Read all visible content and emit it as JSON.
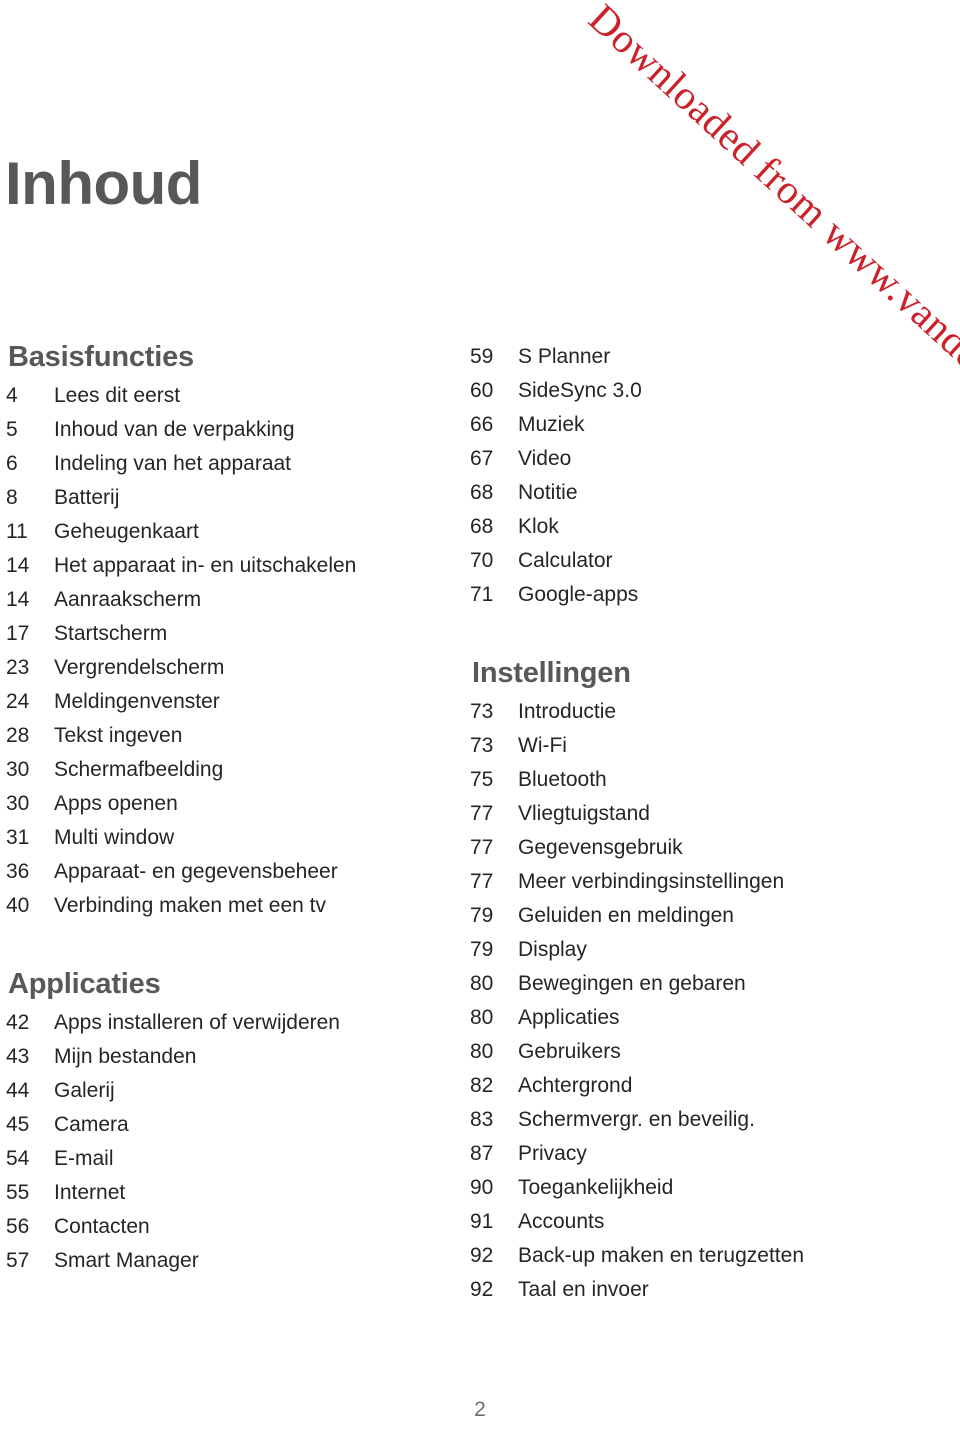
{
  "document": {
    "title": "Inhoud",
    "page_number": "2",
    "watermark_text": "Downloaded from www.vandenborre.be",
    "colors": {
      "watermark_red": "#cc2128",
      "heading_gray": "#58585a",
      "body_text": "#282425",
      "page_number_gray": "#6d6e70",
      "background": "#ffffff"
    }
  },
  "left_column": {
    "sections": [
      {
        "title": "Basisfuncties",
        "entries": [
          {
            "page": "4",
            "label": "Lees dit eerst"
          },
          {
            "page": "5",
            "label": "Inhoud van de verpakking"
          },
          {
            "page": "6",
            "label": "Indeling van het apparaat"
          },
          {
            "page": "8",
            "label": "Batterij"
          },
          {
            "page": "11",
            "label": "Geheugenkaart"
          },
          {
            "page": "14",
            "label": "Het apparaat in- en uitschakelen"
          },
          {
            "page": "14",
            "label": "Aanraakscherm"
          },
          {
            "page": "17",
            "label": "Startscherm"
          },
          {
            "page": "23",
            "label": "Vergrendelscherm"
          },
          {
            "page": "24",
            "label": "Meldingenvenster"
          },
          {
            "page": "28",
            "label": "Tekst ingeven"
          },
          {
            "page": "30",
            "label": "Schermafbeelding"
          },
          {
            "page": "30",
            "label": "Apps openen"
          },
          {
            "page": "31",
            "label": "Multi window"
          },
          {
            "page": "36",
            "label": "Apparaat- en gegevensbeheer"
          },
          {
            "page": "40",
            "label": "Verbinding maken met een tv"
          }
        ]
      },
      {
        "title": "Applicaties",
        "entries": [
          {
            "page": "42",
            "label": "Apps installeren of verwijderen"
          },
          {
            "page": "43",
            "label": "Mijn bestanden"
          },
          {
            "page": "44",
            "label": "Galerij"
          },
          {
            "page": "45",
            "label": "Camera"
          },
          {
            "page": "54",
            "label": "E-mail"
          },
          {
            "page": "55",
            "label": "Internet"
          },
          {
            "page": "56",
            "label": "Contacten"
          },
          {
            "page": "57",
            "label": "Smart Manager"
          }
        ]
      }
    ]
  },
  "right_column": {
    "sections": [
      {
        "title": "",
        "entries": [
          {
            "page": "59",
            "label": "S Planner"
          },
          {
            "page": "60",
            "label": "SideSync 3.0"
          },
          {
            "page": "66",
            "label": "Muziek"
          },
          {
            "page": "67",
            "label": "Video"
          },
          {
            "page": "68",
            "label": "Notitie"
          },
          {
            "page": "68",
            "label": "Klok"
          },
          {
            "page": "70",
            "label": "Calculator"
          },
          {
            "page": "71",
            "label": "Google-apps"
          }
        ]
      },
      {
        "title": "Instellingen",
        "entries": [
          {
            "page": "73",
            "label": "Introductie"
          },
          {
            "page": "73",
            "label": "Wi-Fi"
          },
          {
            "page": "75",
            "label": "Bluetooth"
          },
          {
            "page": "77",
            "label": "Vliegtuigstand"
          },
          {
            "page": "77",
            "label": "Gegevensgebruik"
          },
          {
            "page": "77",
            "label": "Meer verbindingsinstellingen"
          },
          {
            "page": "79",
            "label": "Geluiden en meldingen"
          },
          {
            "page": "79",
            "label": "Display"
          },
          {
            "page": "80",
            "label": "Bewegingen en gebaren"
          },
          {
            "page": "80",
            "label": "Applicaties"
          },
          {
            "page": "80",
            "label": "Gebruikers"
          },
          {
            "page": "82",
            "label": "Achtergrond"
          },
          {
            "page": "83",
            "label": "Schermvergr. en beveilig."
          },
          {
            "page": "87",
            "label": "Privacy"
          },
          {
            "page": "90",
            "label": "Toegankelijkheid"
          },
          {
            "page": "91",
            "label": "Accounts"
          },
          {
            "page": "92",
            "label": "Back-up maken en terugzetten"
          },
          {
            "page": "92",
            "label": "Taal en invoer"
          }
        ]
      }
    ]
  }
}
